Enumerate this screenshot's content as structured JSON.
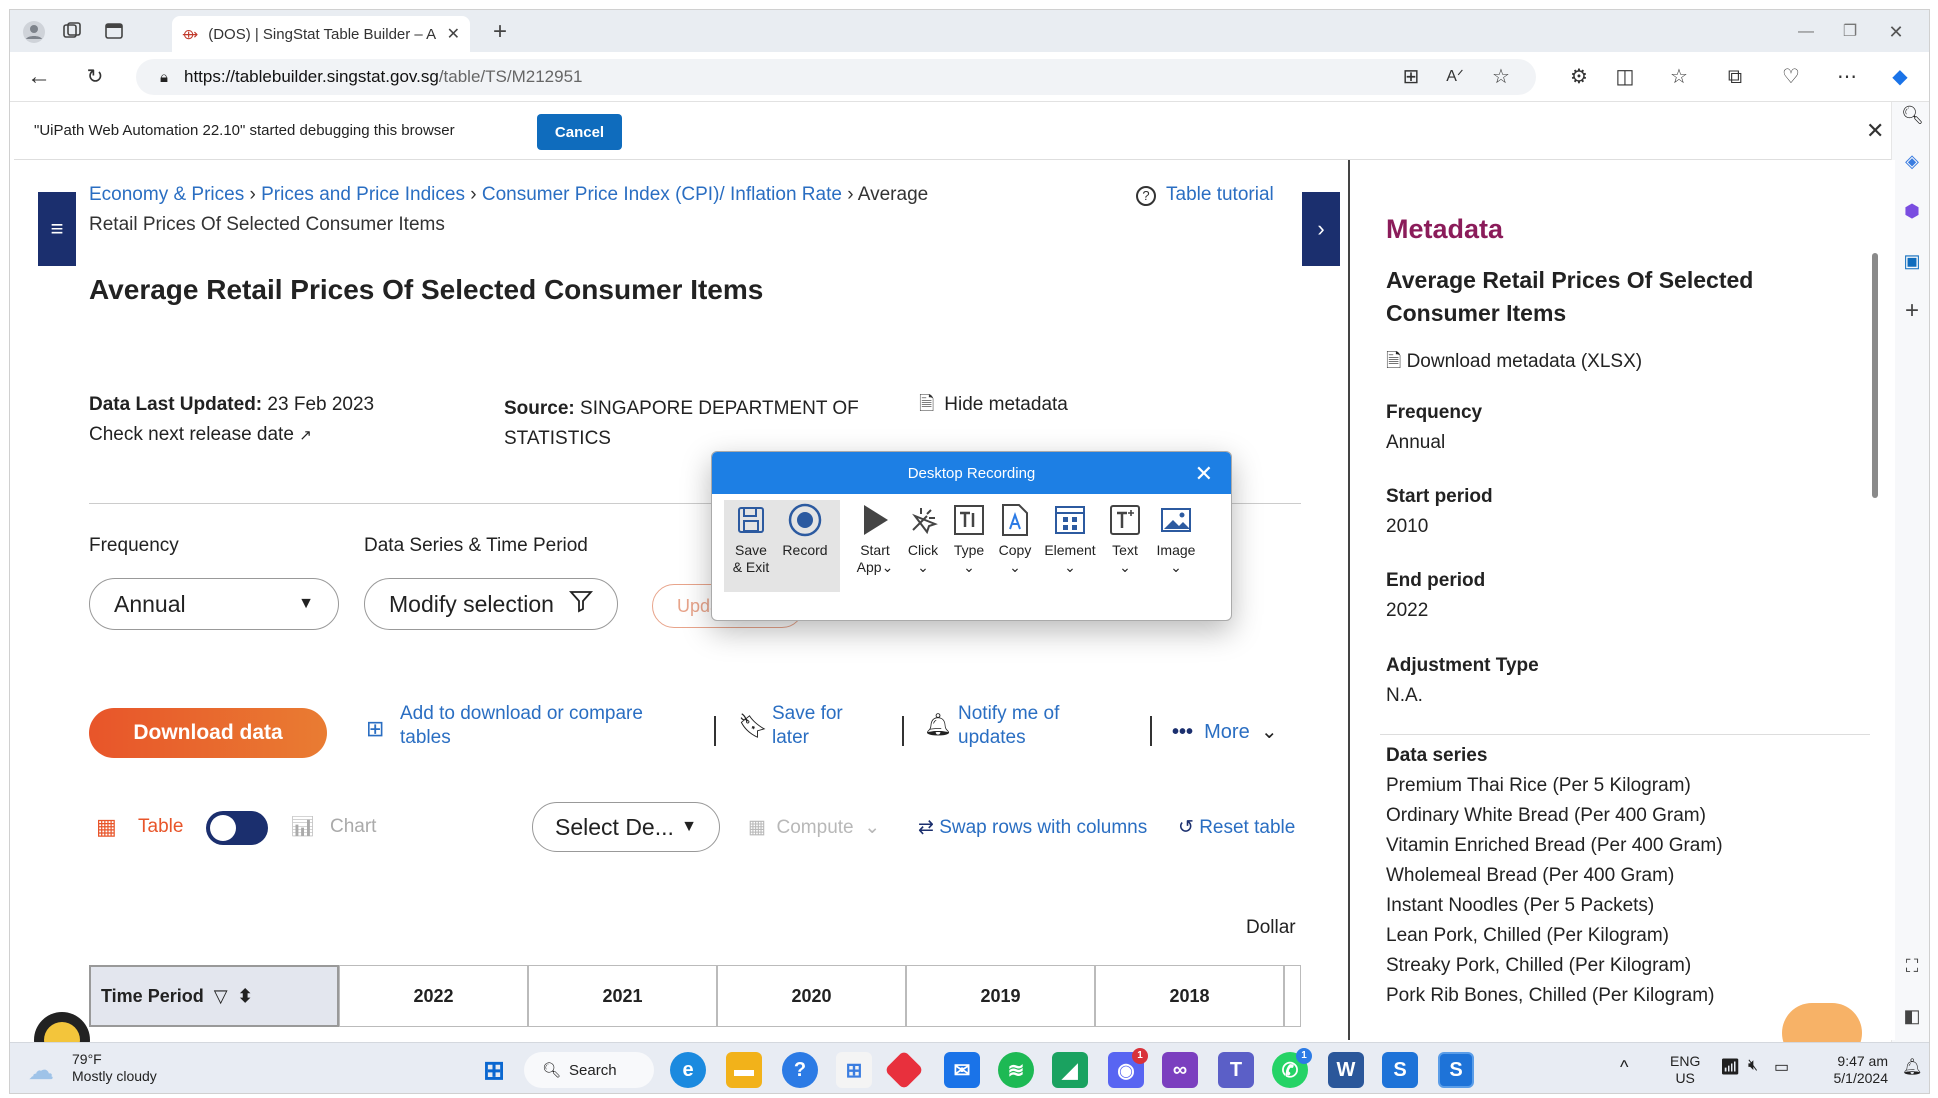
{
  "browser": {
    "tab_title": "(DOS) | SingStat Table Builder – A",
    "url_host": "https://tablebuilder.singstat.gov.sg",
    "url_path": "/table/TS/M212951"
  },
  "infobar": {
    "message": "\"UiPath Web Automation 22.10\" started debugging this browser",
    "cancel_label": "Cancel"
  },
  "breadcrumb": {
    "item1": "Economy & Prices",
    "item2": "Prices and Price Indices",
    "item3": "Consumer Price Index (CPI)/ Inflation Rate",
    "item4a": "Average",
    "item4b": "Retail Prices Of Selected Consumer Items",
    "tutorial": "Table tutorial"
  },
  "page": {
    "title": "Average Retail Prices Of Selected Consumer Items",
    "updated_label": "Data Last Updated:",
    "updated_value": "23 Feb 2023",
    "next_release": "Check next release date",
    "source_label": "Source:",
    "source_value_1": "SINGAPORE DEPARTMENT OF",
    "source_value_2": "STATISTICS",
    "hide_metadata": "Hide metadata",
    "frequency_label": "Frequency",
    "frequency_value": "Annual",
    "series_label": "Data Series & Time Period",
    "modify_label": "Modify selection",
    "update_label": "Upda",
    "download_label": "Download data",
    "add_compare_1": "Add to download or compare",
    "add_compare_2": "tables",
    "save_1": "Save for",
    "save_2": "later",
    "notify_1": "Notify me of",
    "notify_2": "updates",
    "more_label": "More",
    "table_label": "Table",
    "chart_label": "Chart",
    "select_label": "Select De...",
    "compute_label": "Compute",
    "swap_label": "Swap rows with columns",
    "reset_label": "Reset table",
    "unit_label": "Dollar",
    "col_time": "Time Period",
    "years": [
      "2022",
      "2021",
      "2020",
      "2019",
      "2018"
    ]
  },
  "metadata": {
    "heading": "Metadata",
    "title_1": "Average Retail Prices Of Selected",
    "title_2": "Consumer Items",
    "download": "Download metadata (XLSX)",
    "freq_label": "Frequency",
    "freq_value": "Annual",
    "start_label": "Start period",
    "start_value": "2010",
    "end_label": "End period",
    "end_value": "2022",
    "adj_label": "Adjustment Type",
    "adj_value": "N.A.",
    "series_label": "Data series",
    "series": [
      "Premium Thai Rice (Per 5 Kilogram)",
      "Ordinary White Bread (Per 400 Gram)",
      "Vitamin Enriched Bread (Per 400 Gram)",
      "Wholemeal Bread (Per 400 Gram)",
      "Instant Noodles (Per 5 Packets)",
      "Lean Pork, Chilled (Per Kilogram)",
      "Streaky Pork, Chilled (Per Kilogram)",
      "Pork Rib Bones, Chilled (Per Kilogram)"
    ]
  },
  "recorder": {
    "title": "Desktop Recording",
    "tools": [
      "Save\n& Exit",
      "Record",
      "Start\nApp",
      "Click",
      "Type",
      "Copy",
      "Element",
      "Text",
      "Image"
    ]
  },
  "taskbar": {
    "weather_temp": "79°F",
    "weather_desc": "Mostly cloudy",
    "search_label": "Search",
    "lang_1": "ENG",
    "lang_2": "US",
    "time": "9:47 am",
    "date": "5/1/2024",
    "discord_badge": "1",
    "teams_badge": "1"
  },
  "colors": {
    "accent": "#2a6ec2",
    "brand_dark": "#1b2f6e",
    "download": "#e8552a",
    "metadata_heading": "#8b1c5a",
    "recorder": "#1d7fe4"
  }
}
